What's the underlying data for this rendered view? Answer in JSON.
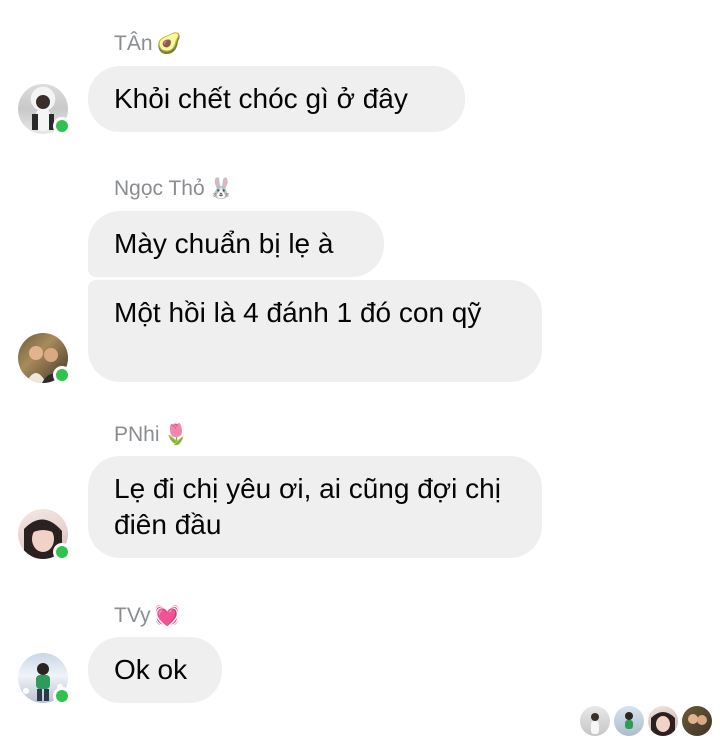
{
  "messages": [
    {
      "sender": "TÂn",
      "sender_emoji": "🥑",
      "lines": [
        "Khỏi chết chóc gì ở đây"
      ]
    },
    {
      "sender": "Ngọc Thỏ",
      "sender_emoji": "🐰",
      "lines": [
        "Mày chuẩn bị lẹ à",
        "Một hồi là 4 đánh 1 đó con qỹ"
      ]
    },
    {
      "sender": "PNhi",
      "sender_emoji": "🌷",
      "lines": [
        "Lẹ đi chị yêu ơi, ai cũng đợi chị điên đầu"
      ]
    },
    {
      "sender": "TVy",
      "sender_emoji": "💓",
      "lines": [
        "Ok ok"
      ]
    }
  ],
  "colors": {
    "bubble": "#efefef",
    "sender_text": "#8a8d91",
    "message_text": "#050505",
    "presence": "#31c24d"
  },
  "icons": [
    "avatar",
    "online-status-icon",
    "seen-avatar"
  ]
}
